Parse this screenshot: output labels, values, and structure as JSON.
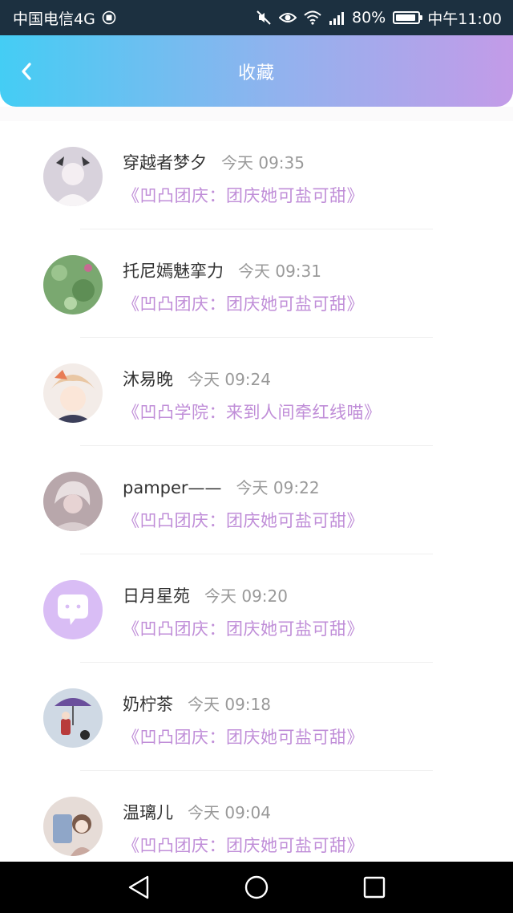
{
  "status_bar": {
    "carrier": "中国电信4G",
    "battery": "80%",
    "time": "中午11:00",
    "icons": [
      "sim-icon",
      "mute-icon",
      "eye-icon",
      "wifi-icon",
      "signal-icon",
      "battery-icon"
    ]
  },
  "header": {
    "title": "收藏",
    "back_icon": "chevron-left-icon"
  },
  "favorites": [
    {
      "name": "穿越者梦夕",
      "time": "今天 09:35",
      "song": "《凹凸团庆：团庆她可盐可甜》",
      "avatar_color": "#d8d2dc"
    },
    {
      "name": "托尼嫣魅挛力",
      "time": "今天 09:31",
      "song": "《凹凸团庆：团庆她可盐可甜》",
      "avatar_color": "#7aa870"
    },
    {
      "name": "沐易晚",
      "time": "今天 09:24",
      "song": "《凹凸学院：来到人间牵红线喵》",
      "avatar_color": "#e9c7a4"
    },
    {
      "name": "pamper——",
      "time": "今天 09:22",
      "song": "《凹凸团庆：团庆她可盐可甜》",
      "avatar_color": "#b8a7ab"
    },
    {
      "name": "日月星苑",
      "time": "今天 09:20",
      "song": "《凹凸团庆：团庆她可盐可甜》",
      "avatar_color": "#d9bdf5"
    },
    {
      "name": "奶柠茶",
      "time": "今天 09:18",
      "song": "《凹凸团庆：团庆她可盐可甜》",
      "avatar_color": "#cfd9e4"
    },
    {
      "name": "温璃儿",
      "time": "今天 09:04",
      "song": "《凹凸团庆：团庆她可盐可甜》",
      "avatar_color": "#e6dcd7"
    }
  ],
  "nav_bar": {
    "icons": [
      "back-triangle-icon",
      "home-circle-icon",
      "recents-square-icon"
    ]
  },
  "colors": {
    "header_gradient": [
      "#44cdf4",
      "#c39be8"
    ],
    "song_text": "#c08ed8",
    "name_text": "#333333",
    "time_text": "#999999"
  }
}
